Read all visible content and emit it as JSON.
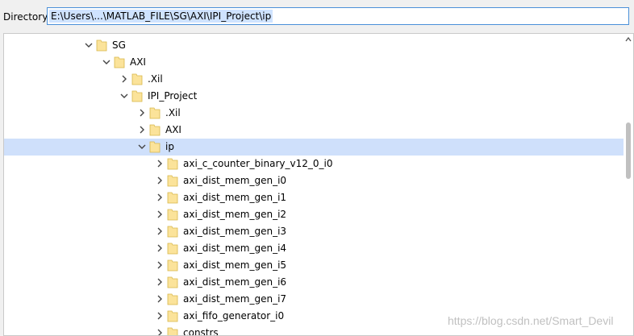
{
  "directory": {
    "label": "Directory:",
    "value": "E:\\Users\\...\\MATLAB_FILE\\SG\\AXI\\IPI_Project\\ip"
  },
  "tree": {
    "rows": [
      {
        "label": "SG",
        "expanded": true
      },
      {
        "label": "AXI",
        "expanded": true
      },
      {
        "label": ".Xil",
        "expanded": false
      },
      {
        "label": "IPI_Project",
        "expanded": true
      },
      {
        "label": ".Xil",
        "expanded": false
      },
      {
        "label": "AXI",
        "expanded": false
      },
      {
        "label": "ip",
        "expanded": true,
        "selected": true
      },
      {
        "label": "axi_c_counter_binary_v12_0_i0",
        "expanded": false
      },
      {
        "label": "axi_dist_mem_gen_i0",
        "expanded": false
      },
      {
        "label": "axi_dist_mem_gen_i1",
        "expanded": false
      },
      {
        "label": "axi_dist_mem_gen_i2",
        "expanded": false
      },
      {
        "label": "axi_dist_mem_gen_i3",
        "expanded": false
      },
      {
        "label": "axi_dist_mem_gen_i4",
        "expanded": false
      },
      {
        "label": "axi_dist_mem_gen_i5",
        "expanded": false
      },
      {
        "label": "axi_dist_mem_gen_i6",
        "expanded": false
      },
      {
        "label": "axi_dist_mem_gen_i7",
        "expanded": false
      },
      {
        "label": "axi_fifo_generator_i0",
        "expanded": false
      },
      {
        "label": "constrs",
        "expanded": false
      }
    ]
  },
  "watermark": "https://blog.csdn.net/Smart_Devil",
  "colors": {
    "selection": "#cfe0fb",
    "folder": "#fbe39a",
    "input_border": "#4a90d9"
  },
  "icons": {
    "expanded": "chevron-down-icon",
    "collapsed": "chevron-right-icon",
    "folder": "folder-icon"
  }
}
